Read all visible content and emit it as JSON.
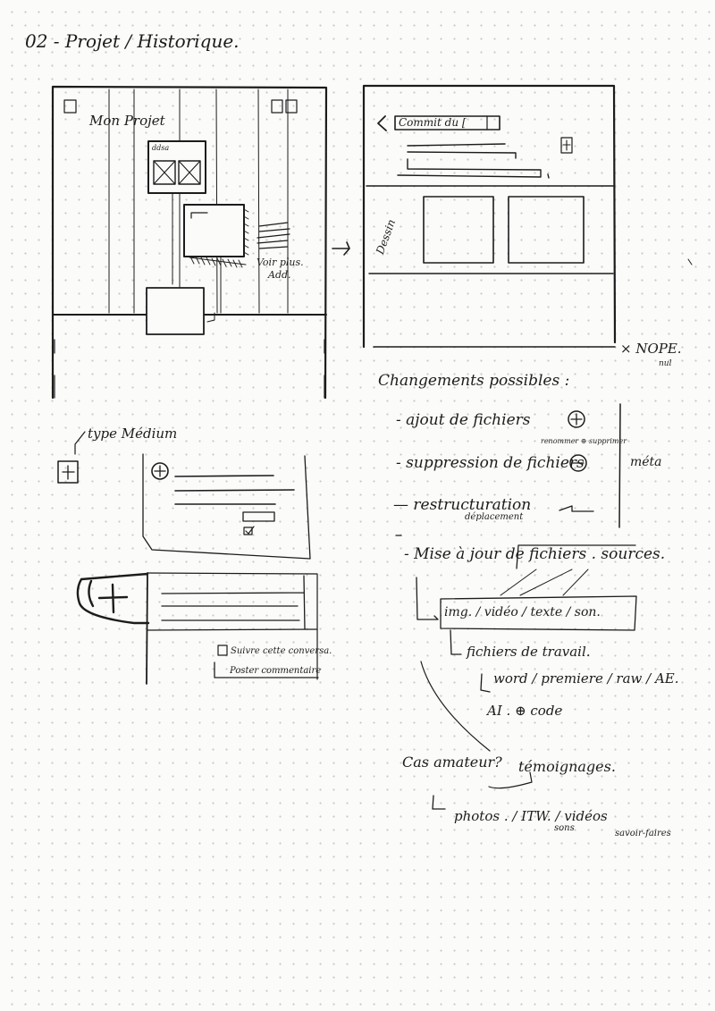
{
  "page": {
    "title": "02 - Projet / Historique."
  },
  "wireframe_project": {
    "title": "Mon Projet",
    "card_label": "ddsa",
    "see_more": "Voir plus.",
    "add_label": "Add."
  },
  "wireframe_commit": {
    "title": "Commit du [",
    "side_label": "Dessin",
    "rejected": "× NOPE.",
    "rejected_note": "nul"
  },
  "type_medium": {
    "label": "type Médium",
    "follow_label": "Suivre cette conversa.",
    "post_button": "Poster commentaire"
  },
  "notes": {
    "heading": "Changements possibles :",
    "add_files": "- ajout de fichiers",
    "delete_files": "- suppression de fichiers",
    "delete_note": "renommer ⊕ supprimer",
    "restructure": "— restructuration",
    "restructure_note": "déplacement",
    "meta": "méta",
    "update_sources": "- Mise à jour de fichiers . sources.",
    "media_types": "img. / vidéo / texte / son.",
    "work_files": "fichiers de travail.",
    "software": "word / premiere / raw / AE.",
    "ai_code": "AI . ⊕ code",
    "amateur": "Cas amateur?",
    "testimonials": "témoignages.",
    "evidence": "photos . /   ITW.   / vidéos",
    "itw_note": "sons",
    "savoir_faire": "savoir-faires"
  }
}
